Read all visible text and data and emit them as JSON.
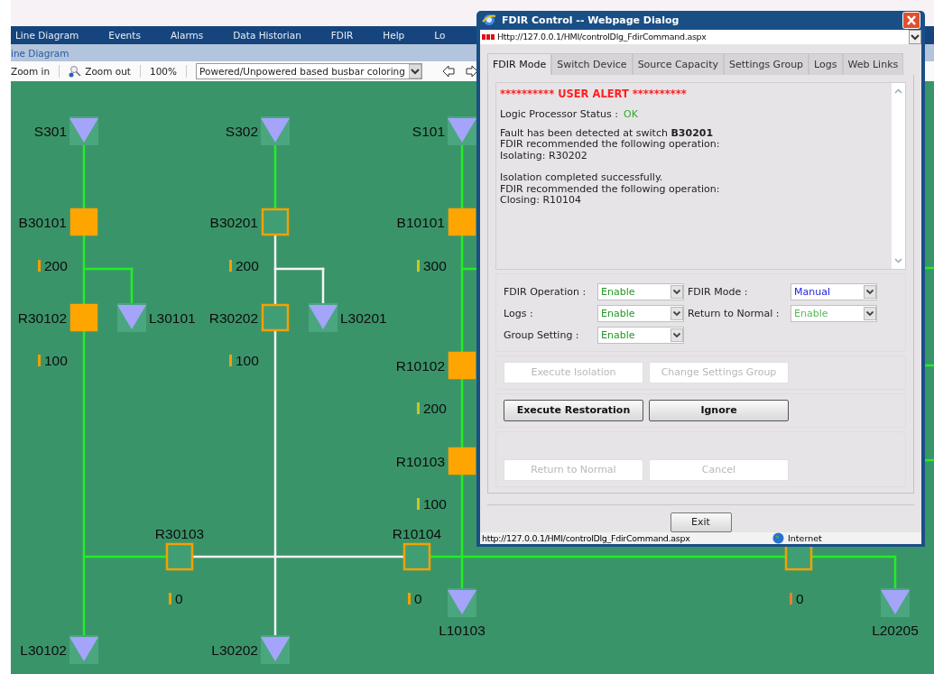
{
  "menu": [
    {
      "label": "Line Diagram"
    },
    {
      "label": "Events"
    },
    {
      "label": "Alarms"
    },
    {
      "label": "Data Historian"
    },
    {
      "label": "FDIR"
    },
    {
      "label": "Help"
    },
    {
      "label": "Lo"
    }
  ],
  "breadcrumb": "ine Diagram",
  "toolbar": {
    "zoom_in": "Zoom in",
    "zoom_out": "Zoom out",
    "zoom_level": "100%",
    "coloring": "Powered/Unpowered based busbar coloring"
  },
  "diagram": {
    "sources": [
      {
        "label": "S301"
      },
      {
        "label": "S302"
      },
      {
        "label": "S101"
      }
    ],
    "switches": [
      {
        "label": "B30101",
        "closed": true
      },
      {
        "label": "B30201",
        "closed": false
      },
      {
        "label": "B10101",
        "closed": true
      },
      {
        "label": "R30102",
        "closed": true
      },
      {
        "label": "R30202",
        "closed": false
      },
      {
        "label": "R10102",
        "closed": true
      },
      {
        "label": "R10103",
        "closed": true
      },
      {
        "label": "R30103",
        "closed": false
      },
      {
        "label": "R10104",
        "closed": false
      },
      {
        "closed": false
      }
    ],
    "loads": [
      {
        "label": "L30101"
      },
      {
        "label": "L30201"
      },
      {
        "label": "L10103"
      },
      {
        "label": "L20205"
      },
      {
        "label": "L30102"
      },
      {
        "label": "L30202"
      }
    ],
    "currents": [
      {
        "value": "200",
        "color": "#f5a000"
      },
      {
        "value": "200",
        "color": "#f5a000"
      },
      {
        "value": "300",
        "color": "#c8c820"
      },
      {
        "value": "100",
        "color": "#f5a000"
      },
      {
        "value": "100",
        "color": "#f5a000"
      },
      {
        "value": "200",
        "color": "#c8c820"
      },
      {
        "value": "100",
        "color": "#c8c820"
      },
      {
        "value": "0",
        "color": "#f5a000"
      },
      {
        "value": "0",
        "color": "#f5a000"
      },
      {
        "value": "0",
        "color": "#e88030"
      }
    ],
    "lines": [
      {
        "energized": true
      },
      {
        "energized": true
      },
      {
        "energized": true
      },
      {
        "energized": true
      },
      {
        "energized": true
      },
      {
        "energized": false
      },
      {
        "energized": true
      },
      {
        "energized": false
      },
      {
        "energized": false
      },
      {
        "energized": false
      },
      {
        "energized": true
      },
      {
        "energized": true
      },
      {
        "energized": true
      },
      {
        "energized": true
      },
      {
        "energized": true
      },
      {
        "energized": true
      },
      {
        "energized": true
      },
      {
        "energized": true
      },
      {
        "energized": true
      },
      {
        "energized": true
      }
    ]
  },
  "dialog": {
    "title": "FDIR Control -- Webpage Dialog",
    "url": "Http://127.0.0.1/HMI/controlDlg_FdirCommand.aspx",
    "tabs": [
      {
        "label": "FDIR Mode",
        "selected": true
      },
      {
        "label": "Switch Device",
        "selected": false
      },
      {
        "label": "Source Capacity",
        "selected": false
      },
      {
        "label": "Settings Group",
        "selected": false
      },
      {
        "label": "Logs",
        "selected": false
      },
      {
        "label": "Web Links",
        "selected": false
      }
    ],
    "alert": "********** USER ALERT **********",
    "status_label": "Logic Processor Status  :",
    "status_value": "OK",
    "messages": [
      [
        "Fault has been detected at switch **B30201**",
        "FDIR recommended the following operation:",
        "Isolating: R30202"
      ],
      [
        "Isolation completed successfully.",
        "FDIR recommended the following operation:",
        "Closing: R10104"
      ]
    ],
    "settings": [
      {
        "label": "FDIR Operation :",
        "value": "Enable",
        "color": "#229922"
      },
      {
        "label": "FDIR Mode :",
        "value": "Manual",
        "color": "#2222dd"
      },
      {
        "label": "Logs :",
        "value": "Enable",
        "color": "#229922"
      },
      {
        "label": "Return to Normal :",
        "value": "Enable",
        "color": "#55bb55"
      },
      {
        "label": "Group Setting :",
        "value": "Enable",
        "color": "#229922"
      }
    ],
    "button_rows": [
      [
        {
          "label": "Execute Isolation",
          "disabled": true
        },
        {
          "label": "Change Settings Group",
          "disabled": true
        }
      ],
      [
        {
          "label": "Execute Restoration",
          "disabled": false
        },
        {
          "label": "Ignore",
          "disabled": false
        }
      ],
      [
        {
          "label": "Return to Normal",
          "disabled": true
        },
        {
          "label": "Cancel",
          "disabled": true
        }
      ]
    ],
    "exit": "Exit",
    "status_bar": {
      "url": "http://127.0.0.1/HMI/controlDlg_FdirCommand.aspx",
      "zone": "Internet"
    }
  }
}
